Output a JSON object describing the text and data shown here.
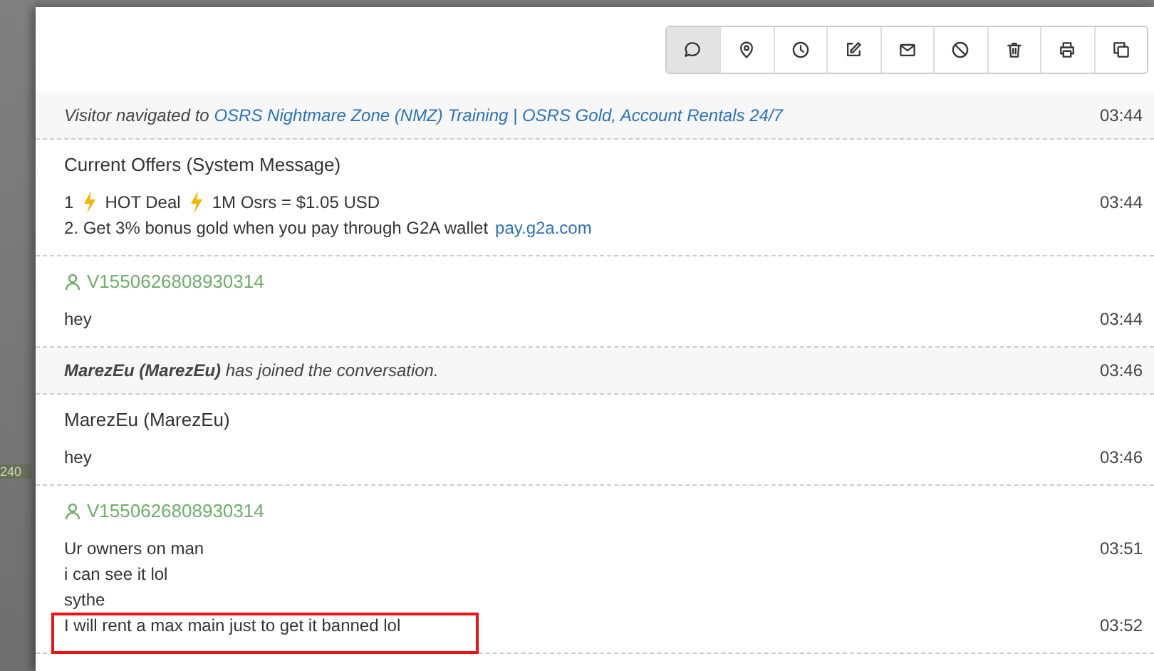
{
  "backdrop": {
    "badge": "240"
  },
  "toolbar": [
    {
      "selected": true
    },
    {
      "selected": false
    },
    {
      "selected": false
    },
    {
      "selected": false
    },
    {
      "selected": false
    },
    {
      "selected": false
    },
    {
      "selected": false
    },
    {
      "selected": false
    },
    {
      "selected": false
    }
  ],
  "entries": [
    {
      "kind": "event",
      "parts": [
        {
          "kind": "text",
          "text": "Visitor navigated to "
        },
        {
          "kind": "link",
          "text": "OSRS Nightmare Zone (NMZ) Training | OSRS Gold, Account Rentals 24/7"
        }
      ],
      "time": "03:44"
    },
    {
      "kind": "message",
      "sender": {
        "kind": "plain",
        "name": "Current Offers (System Message)"
      },
      "lines": [
        {
          "parts": [
            {
              "kind": "text",
              "text": "1"
            },
            {
              "kind": "bolt"
            },
            {
              "kind": "text",
              "text": "HOT Deal"
            },
            {
              "kind": "bolt"
            },
            {
              "kind": "text",
              "text": "1M Osrs = $1.05 USD"
            }
          ],
          "time": "03:44",
          "highlighted": false
        },
        {
          "parts": [
            {
              "kind": "text",
              "text": "2. Get 3% bonus gold when you pay through G2A wallet "
            },
            {
              "kind": "link",
              "text": "pay.g2a.com"
            }
          ],
          "highlighted": false
        }
      ]
    },
    {
      "kind": "message",
      "sender": {
        "kind": "visitor",
        "name": "V1550626808930314"
      },
      "lines": [
        {
          "parts": [
            {
              "kind": "text",
              "text": "hey"
            }
          ],
          "time": "03:44",
          "highlighted": false
        }
      ]
    },
    {
      "kind": "event",
      "parts": [
        {
          "kind": "text",
          "text": "**MarezEu (MarezEu)** has joined the conversation."
        }
      ],
      "time": "03:46"
    },
    {
      "kind": "message",
      "sender": {
        "kind": "plain",
        "name": "MarezEu (MarezEu)"
      },
      "lines": [
        {
          "parts": [
            {
              "kind": "text",
              "text": "hey"
            }
          ],
          "time": "03:46",
          "highlighted": false
        }
      ]
    },
    {
      "kind": "message",
      "sender": {
        "kind": "visitor",
        "name": "V1550626808930314"
      },
      "lines": [
        {
          "parts": [
            {
              "kind": "text",
              "text": "Ur owners on man"
            }
          ],
          "time": "03:51",
          "highlighted": false
        },
        {
          "parts": [
            {
              "kind": "text",
              "text": "i can see it lol"
            }
          ],
          "highlighted": false
        },
        {
          "parts": [
            {
              "kind": "text",
              "text": "sythe"
            }
          ],
          "highlighted": false
        },
        {
          "parts": [
            {
              "kind": "text",
              "text": "I will rent a max main just to get it banned lol"
            }
          ],
          "time": "03:52",
          "highlighted": true
        }
      ]
    }
  ]
}
